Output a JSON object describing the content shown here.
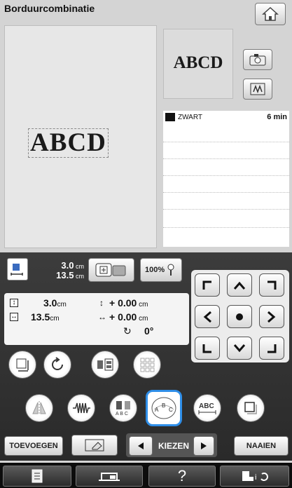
{
  "header": {
    "title": "Borduurcombinatie"
  },
  "preview": {
    "text": "ABCD"
  },
  "mini_preview": {
    "text": "ABCD"
  },
  "thread_list": [
    {
      "color": "#111111",
      "name": "ZWART",
      "time": "6 min"
    }
  ],
  "size_summary": {
    "width_value": "3.0",
    "width_unit": "cm",
    "height_value": "13.5",
    "height_unit": "cm",
    "zoom_label": "100%"
  },
  "position_panel": {
    "height_value": "3.0",
    "height_unit": "cm",
    "width_value": "13.5",
    "width_unit": "cm",
    "offset_y": "+ 0.00",
    "offset_y_unit": "cm",
    "offset_x": "+ 0.00",
    "offset_x_unit": "cm",
    "rotation": "0°"
  },
  "bottom_bar": {
    "add_label": "TOEVOEGEN",
    "select_label": "KIEZEN",
    "sew_label": "NAAIEN"
  },
  "footer": {
    "help_label": "?"
  },
  "colors": {
    "panel": "#333333",
    "selected_border": "#2f8ee8"
  }
}
